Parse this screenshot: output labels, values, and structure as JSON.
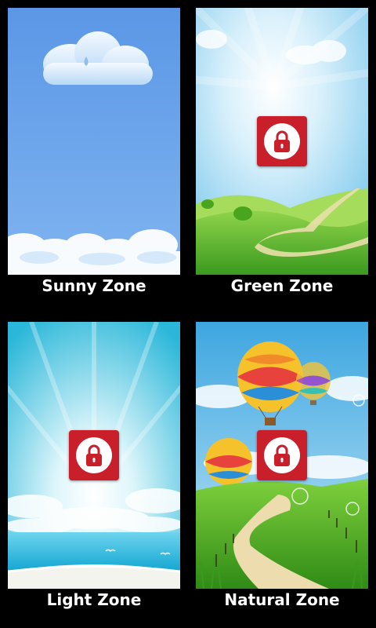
{
  "themes": [
    {
      "label": "Sunny Zone",
      "locked": false
    },
    {
      "label": "Green Zone",
      "locked": true
    },
    {
      "label": "Light Zone",
      "locked": true
    },
    {
      "label": "Natural Zone",
      "locked": true
    }
  ],
  "colors": {
    "background": "#000000",
    "lock_badge": "#c81f2b",
    "label_text": "#ffffff"
  }
}
